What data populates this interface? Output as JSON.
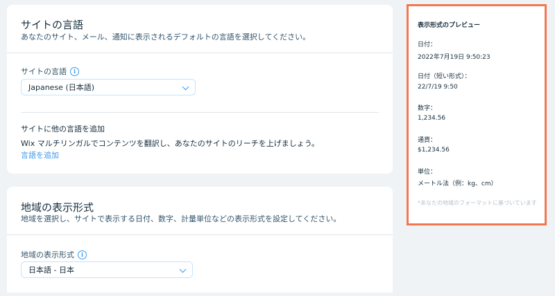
{
  "site_language": {
    "title": "サイトの言語",
    "subtitle": "あなたのサイト、メール、通知に表示されるデフォルトの言語を選択してください。",
    "field_label": "サイトの言語",
    "selected_language": "Japanese (日本語)",
    "add_section_title": "サイトに他の言語を追加",
    "add_section_body": "Wix マルチリンガルでコンテンツを翻訳し、あなたのサイトのリーチを上げましょう。",
    "add_link": "言語を追加"
  },
  "regional_format": {
    "title": "地域の表示形式",
    "subtitle": "地域を選択し、サイトで表示する日付、数字、計量単位などの表示形式を設定してください。",
    "field_label": "地域の表示形式",
    "selected_region": "日本語 - 日本"
  },
  "preview": {
    "title": "表示形式のプレビュー",
    "date_label": "日付：",
    "date_value": "2022年7月19日 9:50:23",
    "short_date_label": "日付（短い形式）：",
    "short_date_value": "22/7/19 9:50",
    "number_label": "数字：",
    "number_value": "1,234.56",
    "currency_label": "通貨：",
    "currency_value": "$1,234.56",
    "units_label": "単位：",
    "units_value": "メートル法（例：kg、cm）",
    "note": "*あなたの地域のフォーマットに基づいています"
  },
  "colors": {
    "accent": "#3899ec",
    "highlight_border": "#f2764f",
    "background": "#f0f3f5"
  }
}
